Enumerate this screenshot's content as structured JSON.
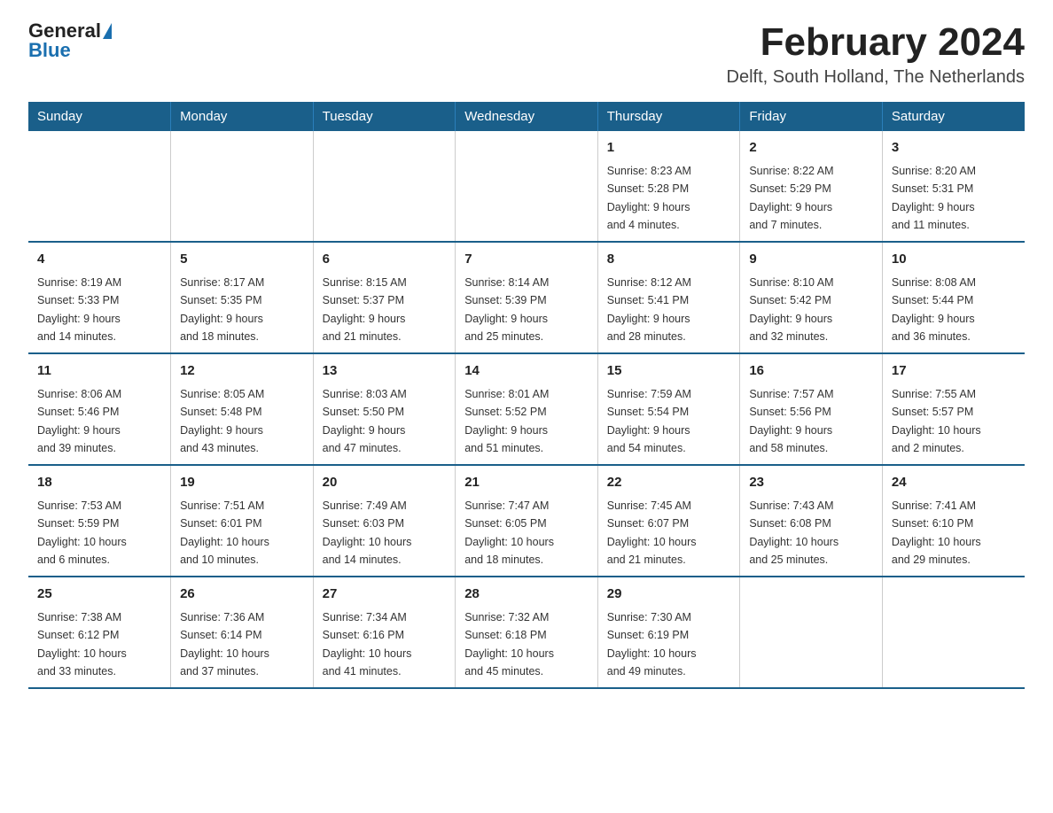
{
  "header": {
    "logo_general": "General",
    "logo_blue": "Blue",
    "title": "February 2024",
    "subtitle": "Delft, South Holland, The Netherlands"
  },
  "calendar": {
    "days_of_week": [
      "Sunday",
      "Monday",
      "Tuesday",
      "Wednesday",
      "Thursday",
      "Friday",
      "Saturday"
    ],
    "weeks": [
      [
        {
          "date": "",
          "info": ""
        },
        {
          "date": "",
          "info": ""
        },
        {
          "date": "",
          "info": ""
        },
        {
          "date": "",
          "info": ""
        },
        {
          "date": "1",
          "info": "Sunrise: 8:23 AM\nSunset: 5:28 PM\nDaylight: 9 hours\nand 4 minutes."
        },
        {
          "date": "2",
          "info": "Sunrise: 8:22 AM\nSunset: 5:29 PM\nDaylight: 9 hours\nand 7 minutes."
        },
        {
          "date": "3",
          "info": "Sunrise: 8:20 AM\nSunset: 5:31 PM\nDaylight: 9 hours\nand 11 minutes."
        }
      ],
      [
        {
          "date": "4",
          "info": "Sunrise: 8:19 AM\nSunset: 5:33 PM\nDaylight: 9 hours\nand 14 minutes."
        },
        {
          "date": "5",
          "info": "Sunrise: 8:17 AM\nSunset: 5:35 PM\nDaylight: 9 hours\nand 18 minutes."
        },
        {
          "date": "6",
          "info": "Sunrise: 8:15 AM\nSunset: 5:37 PM\nDaylight: 9 hours\nand 21 minutes."
        },
        {
          "date": "7",
          "info": "Sunrise: 8:14 AM\nSunset: 5:39 PM\nDaylight: 9 hours\nand 25 minutes."
        },
        {
          "date": "8",
          "info": "Sunrise: 8:12 AM\nSunset: 5:41 PM\nDaylight: 9 hours\nand 28 minutes."
        },
        {
          "date": "9",
          "info": "Sunrise: 8:10 AM\nSunset: 5:42 PM\nDaylight: 9 hours\nand 32 minutes."
        },
        {
          "date": "10",
          "info": "Sunrise: 8:08 AM\nSunset: 5:44 PM\nDaylight: 9 hours\nand 36 minutes."
        }
      ],
      [
        {
          "date": "11",
          "info": "Sunrise: 8:06 AM\nSunset: 5:46 PM\nDaylight: 9 hours\nand 39 minutes."
        },
        {
          "date": "12",
          "info": "Sunrise: 8:05 AM\nSunset: 5:48 PM\nDaylight: 9 hours\nand 43 minutes."
        },
        {
          "date": "13",
          "info": "Sunrise: 8:03 AM\nSunset: 5:50 PM\nDaylight: 9 hours\nand 47 minutes."
        },
        {
          "date": "14",
          "info": "Sunrise: 8:01 AM\nSunset: 5:52 PM\nDaylight: 9 hours\nand 51 minutes."
        },
        {
          "date": "15",
          "info": "Sunrise: 7:59 AM\nSunset: 5:54 PM\nDaylight: 9 hours\nand 54 minutes."
        },
        {
          "date": "16",
          "info": "Sunrise: 7:57 AM\nSunset: 5:56 PM\nDaylight: 9 hours\nand 58 minutes."
        },
        {
          "date": "17",
          "info": "Sunrise: 7:55 AM\nSunset: 5:57 PM\nDaylight: 10 hours\nand 2 minutes."
        }
      ],
      [
        {
          "date": "18",
          "info": "Sunrise: 7:53 AM\nSunset: 5:59 PM\nDaylight: 10 hours\nand 6 minutes."
        },
        {
          "date": "19",
          "info": "Sunrise: 7:51 AM\nSunset: 6:01 PM\nDaylight: 10 hours\nand 10 minutes."
        },
        {
          "date": "20",
          "info": "Sunrise: 7:49 AM\nSunset: 6:03 PM\nDaylight: 10 hours\nand 14 minutes."
        },
        {
          "date": "21",
          "info": "Sunrise: 7:47 AM\nSunset: 6:05 PM\nDaylight: 10 hours\nand 18 minutes."
        },
        {
          "date": "22",
          "info": "Sunrise: 7:45 AM\nSunset: 6:07 PM\nDaylight: 10 hours\nand 21 minutes."
        },
        {
          "date": "23",
          "info": "Sunrise: 7:43 AM\nSunset: 6:08 PM\nDaylight: 10 hours\nand 25 minutes."
        },
        {
          "date": "24",
          "info": "Sunrise: 7:41 AM\nSunset: 6:10 PM\nDaylight: 10 hours\nand 29 minutes."
        }
      ],
      [
        {
          "date": "25",
          "info": "Sunrise: 7:38 AM\nSunset: 6:12 PM\nDaylight: 10 hours\nand 33 minutes."
        },
        {
          "date": "26",
          "info": "Sunrise: 7:36 AM\nSunset: 6:14 PM\nDaylight: 10 hours\nand 37 minutes."
        },
        {
          "date": "27",
          "info": "Sunrise: 7:34 AM\nSunset: 6:16 PM\nDaylight: 10 hours\nand 41 minutes."
        },
        {
          "date": "28",
          "info": "Sunrise: 7:32 AM\nSunset: 6:18 PM\nDaylight: 10 hours\nand 45 minutes."
        },
        {
          "date": "29",
          "info": "Sunrise: 7:30 AM\nSunset: 6:19 PM\nDaylight: 10 hours\nand 49 minutes."
        },
        {
          "date": "",
          "info": ""
        },
        {
          "date": "",
          "info": ""
        }
      ]
    ]
  }
}
